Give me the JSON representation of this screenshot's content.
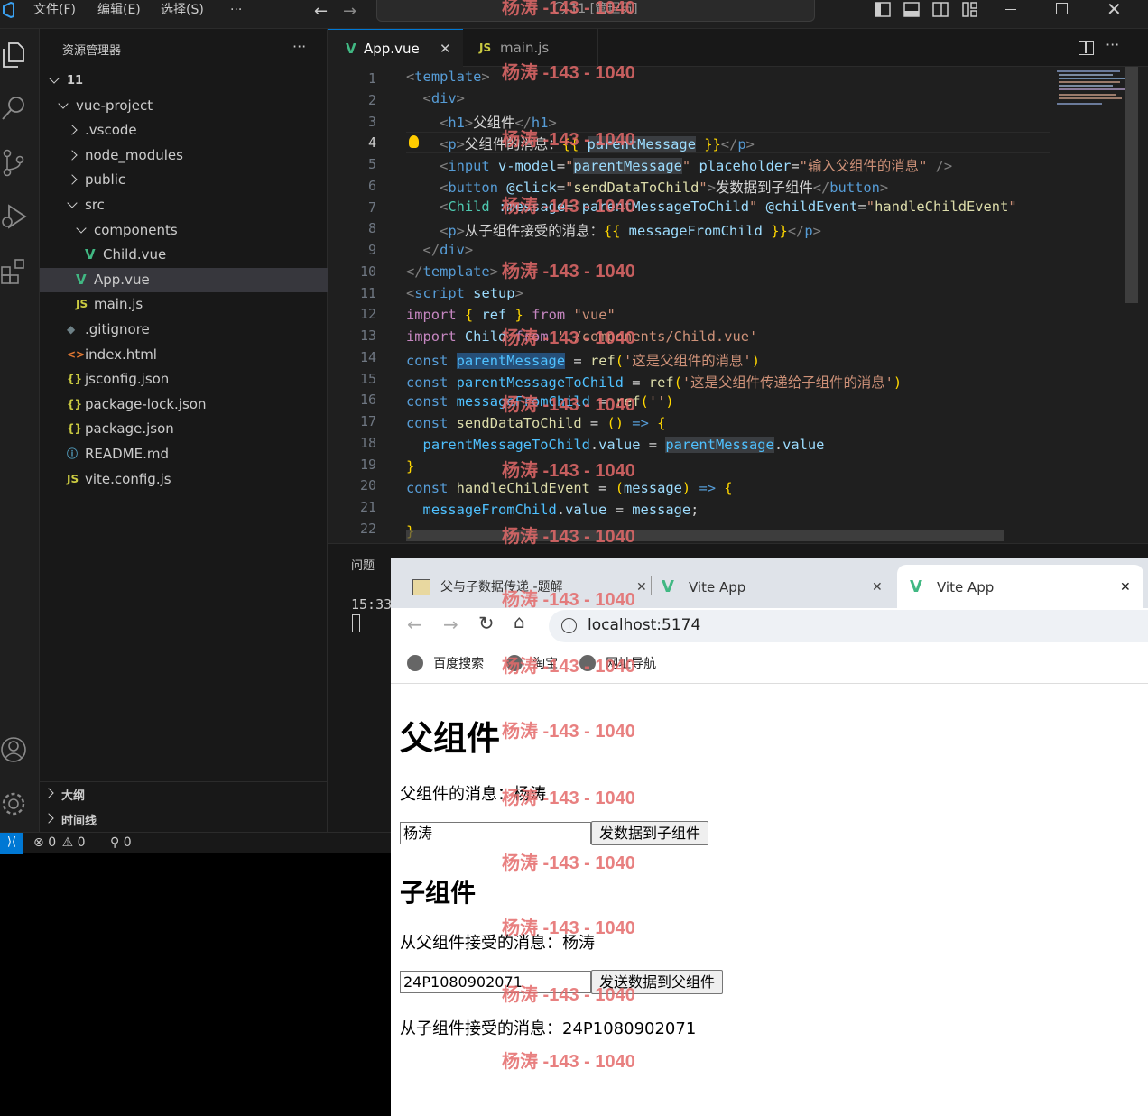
{
  "titlebar": {
    "menu": [
      "文件(F)",
      "编辑(E)",
      "选择(S)",
      "···"
    ],
    "command_center": "11 [管理员]"
  },
  "sidebar": {
    "title": "资源管理器",
    "more": "···",
    "tree": [
      {
        "label": "11",
        "type": "folder-open",
        "depth": 0
      },
      {
        "label": "vue-project",
        "type": "folder-open",
        "depth": 1
      },
      {
        "label": ".vscode",
        "type": "folder",
        "depth": 2
      },
      {
        "label": "node_modules",
        "type": "folder",
        "depth": 2
      },
      {
        "label": "public",
        "type": "folder",
        "depth": 2
      },
      {
        "label": "src",
        "type": "folder-open",
        "depth": 2
      },
      {
        "label": "components",
        "type": "folder-open",
        "depth": 3
      },
      {
        "label": "Child.vue",
        "type": "vue",
        "depth": 4
      },
      {
        "label": "App.vue",
        "type": "vue",
        "depth": 3,
        "active": true
      },
      {
        "label": "main.js",
        "type": "js",
        "depth": 3
      },
      {
        "label": ".gitignore",
        "type": "git",
        "depth": 2
      },
      {
        "label": "index.html",
        "type": "html",
        "depth": 2
      },
      {
        "label": "jsconfig.json",
        "type": "json",
        "depth": 2
      },
      {
        "label": "package-lock.json",
        "type": "json",
        "depth": 2
      },
      {
        "label": "package.json",
        "type": "json",
        "depth": 2
      },
      {
        "label": "README.md",
        "type": "info",
        "depth": 2
      },
      {
        "label": "vite.config.js",
        "type": "js",
        "depth": 2
      }
    ],
    "outline": "大纲",
    "timeline": "时间线"
  },
  "editor": {
    "tabs": [
      {
        "label": "App.vue",
        "icon": "vue",
        "active": true
      },
      {
        "label": "main.js",
        "icon": "js"
      }
    ],
    "line_numbers": [
      "1",
      "2",
      "3",
      "4",
      "5",
      "6",
      "7",
      "8",
      "9",
      "10",
      "11",
      "12",
      "13",
      "14",
      "15",
      "16",
      "17",
      "18",
      "19",
      "20",
      "21",
      "22"
    ],
    "current_line": "4"
  },
  "panel": {
    "title": "问题",
    "terminal_time": "15:33"
  },
  "statusbar": {
    "errors": "0",
    "warnings": "0",
    "ports": "0"
  },
  "browser": {
    "tabs": [
      {
        "label": "父与子数据传递 -题解"
      },
      {
        "label": "Vite App"
      },
      {
        "label": "Vite App",
        "active": true
      }
    ],
    "address": "localhost:5174",
    "bookmarks": [
      "百度搜索",
      "淘宝",
      "网址导航"
    ],
    "page": {
      "h1": "父组件",
      "parent_msg_label": "父组件的消息：",
      "parent_msg_value": "杨涛",
      "parent_input": "杨涛",
      "parent_button": "发数据到子组件",
      "h2": "子组件",
      "child_received_label": "从父组件接受的消息：",
      "child_received_value": "杨涛",
      "child_input": "24P1080902071",
      "child_button": "发送数据到父组件",
      "from_child_label": "从子组件接受的消息：",
      "from_child_value": "24P1080902071"
    }
  },
  "watermark": "杨涛 -143 - 1040",
  "colors": {
    "vue_green": "#41b883",
    "js_yellow": "#cbcb41",
    "json_yellow": "#cbcb41",
    "accent_blue": "#0078d4",
    "watermark": "#e46a6a"
  }
}
